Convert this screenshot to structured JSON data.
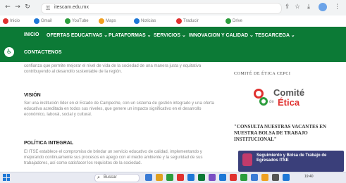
{
  "browser": {
    "url": "itescam.edu.mx",
    "bookmarks": [
      {
        "label": "Inicio",
        "color": "#e0312f"
      },
      {
        "label": "Gmail",
        "color": "#1e78d6"
      },
      {
        "label": "YouTube",
        "color": "#2c9d3c"
      },
      {
        "label": "Maps",
        "color": "#f0a020"
      },
      {
        "label": "Noticias",
        "color": "#1e78d6"
      },
      {
        "label": "Traducir",
        "color": "#e0312f"
      },
      {
        "label": "Drive",
        "color": "#2c9d3c"
      }
    ]
  },
  "nav": {
    "items": [
      {
        "label": "INICIO"
      },
      {
        "label": "OFERTAS EDUCATIVAS ⌄"
      },
      {
        "label": "PLATAFORMAS ⌄"
      },
      {
        "label": "SERVICIOS ⌄"
      },
      {
        "label": "INNOVACION Y CALIDAD ⌄"
      },
      {
        "label": "TESCARCEGA ⌄"
      }
    ],
    "contact": "CONTACTENOS"
  },
  "content": {
    "intro": "confianza que permite mejorar el nivel de vida de la sociedad de una manera justa y equitativa contribuyendo al desarrollo sustentable de la región.",
    "vision_title": "VISIÓN",
    "vision_text": "Ser una institución líder en el Estado de Campeche, con un sistema de gestión integrado y una oferta educativa acreditada en todos sus niveles, que genere un impacto significativo en el desarrollo económico, laboral, social y cultural.",
    "policy_title": "POLÍTICA INTEGRAL",
    "policy_text": "El ITSE establece el compromiso de brindar un servicio educativo de calidad, implementando y mejorando continuamente sus procesos en apego con el medio ambiente y la seguridad de sus trabajadores, así como satisfacer los requisitos de la sociedad."
  },
  "sidebar": {
    "ethics_title": "COMITÉ DE ÉTICA CEPCI",
    "logo_word1": "Comité",
    "logo_word2": "de",
    "logo_word3": "Ética",
    "vacancies": "\"CONSULTA NUESTRAS VACANTES EN NUESTRA BOLSA DE TRABAJO INSTITUCIONAL\"",
    "promo": "Seguimiento y Bolsa de Trabajo de Egresados ITSE"
  },
  "taskbar": {
    "search": "Buscar",
    "apps": [
      "#3a7bd5",
      "#e0a020",
      "#2c9d3c",
      "#e0312f",
      "#1e78d6",
      "#0c7a36",
      "#7b4fc4",
      "#1e78d6",
      "#e0312f",
      "#2c9d3c",
      "#3a7bd5",
      "#f0a020",
      "#555555",
      "#1e78d6"
    ],
    "clock": "19:40"
  }
}
